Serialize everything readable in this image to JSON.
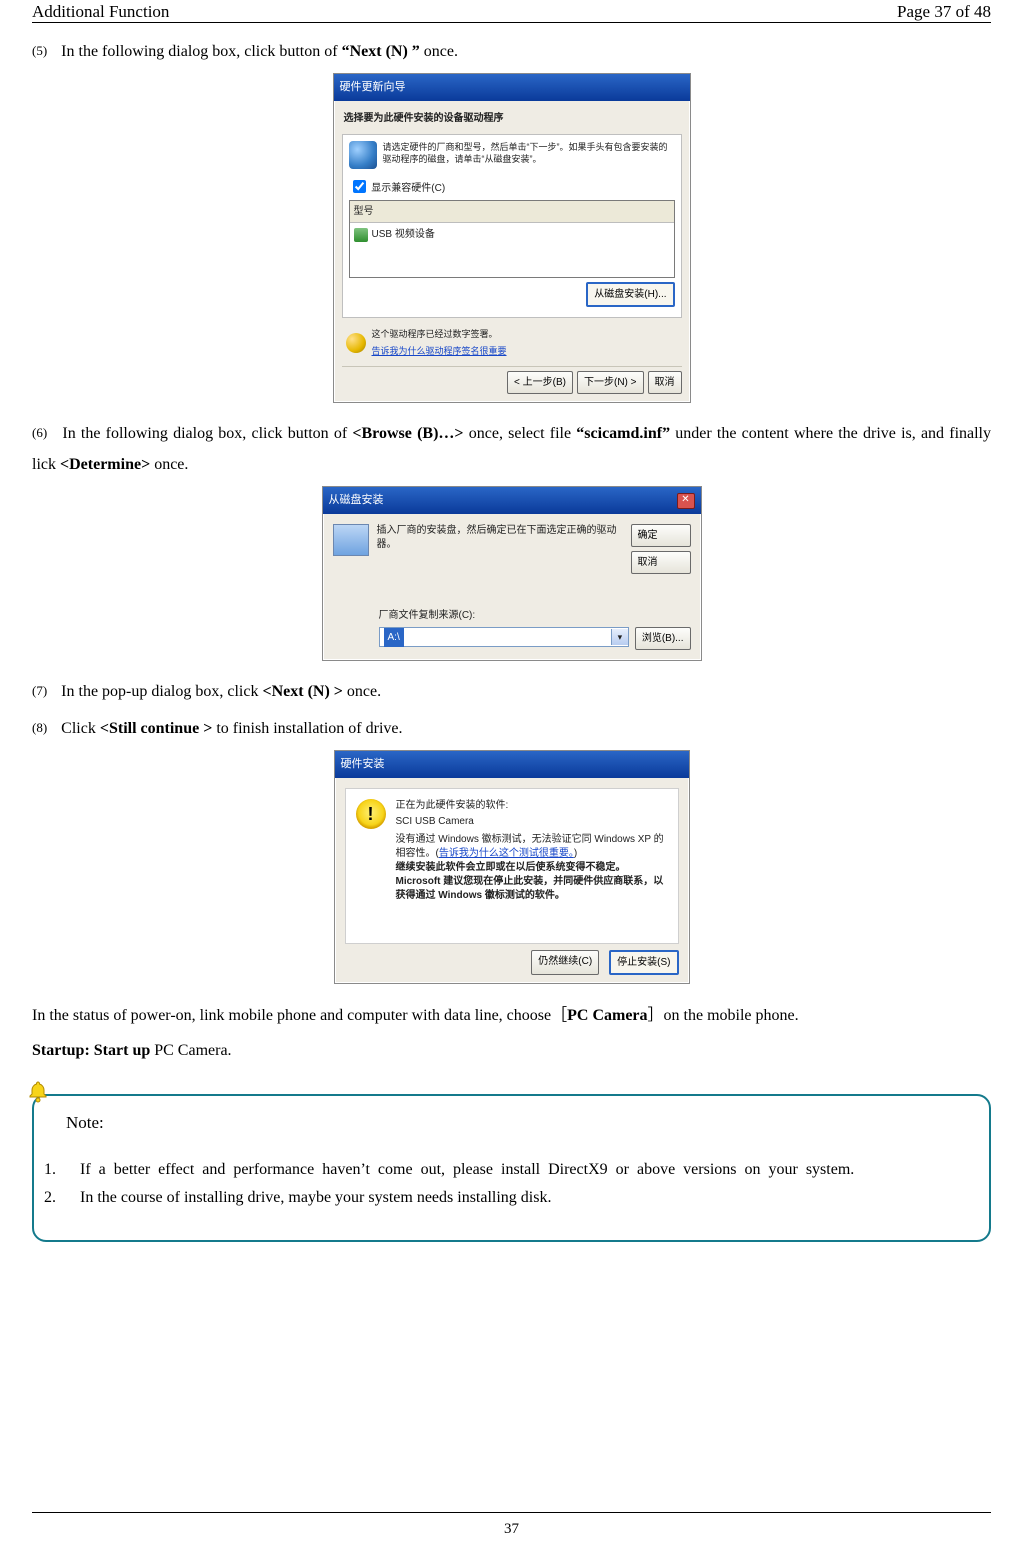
{
  "header": {
    "left": "Additional Function",
    "right": "Page 37 of 48"
  },
  "step5": {
    "num": "(5)",
    "pre": "In the following dialog box, click button of ",
    "bold": "“Next (N) ”",
    "post": " once."
  },
  "dlg1": {
    "title": "硬件更新向导",
    "sub": "选择要为此硬件安装的设备驱动程序",
    "desc": "请选定硬件的厂商和型号，然后单击“下一步”。如果手头有包含要安装的驱动程序的磁盘，请单击“从磁盘安装”。",
    "chk": "显示兼容硬件(C)",
    "listHeader": "型号",
    "listItem": "USB 视频设备",
    "diskBtn": "从磁盘安装(H)...",
    "signed": "这个驱动程序已经过数字签署。",
    "tellLink": "告诉我为什么驱动程序签名很重要",
    "back": "< 上一步(B)",
    "next": "下一步(N) >",
    "cancel": "取消"
  },
  "step6": {
    "num": "(6)",
    "pre": "In the following dialog box, click button of ",
    "b1": "<Browse (B)…>",
    "mid1": " once, select file ",
    "b2": "“scicamd.inf”",
    "mid2": " under the content where the drive is, and finally lick ",
    "b3": "<Determine>",
    "post": " once."
  },
  "dlg2": {
    "title": "从磁盘安装",
    "desc": "插入厂商的安装盘，然后确定已在下面选定正确的驱动器。",
    "ok": "确定",
    "cancel": "取消",
    "srcLabel": "厂商文件复制来源(C):",
    "selected": "A:\\",
    "browse": "浏览(B)..."
  },
  "step7": {
    "num": "(7)",
    "pre": "In the pop-up dialog box, click ",
    "b": "<Next (N) >",
    "post": " once."
  },
  "step8": {
    "num": "(8)",
    "pre": "Click",
    "b": "<Still continue >",
    "post": " to finish installation of drive."
  },
  "dlg3": {
    "title": "硬件安装",
    "l1": "正在为此硬件安装的软件:",
    "name": "SCI USB Camera",
    "l2a": "没有通过 Windows 徽标测试，无法验证它同 Windows XP 的相容性。(",
    "l2link": "告诉我为什么这个测试很重要。",
    "l2b": ")",
    "l3": "继续安装此软件会立即或在以后使系统变得不稳定。Microsoft 建议您现在停止此安装，并同硬件供应商联系，以获得通过 Windows 徽标测试的软件。",
    "cont": "仍然继续(C)",
    "stop": "停止安装(S)"
  },
  "para": {
    "pre": "In the status of power-on, link mobile phone and computer with data line, choose［",
    "b": "PC Camera",
    "post": "］on the mobile phone."
  },
  "startup": {
    "b": "Startup: Start up ",
    "t": "PC Camera."
  },
  "note": {
    "title": "Note:",
    "i1n": "1.",
    "i1t": "If a better effect and performance haven’t come out, please install DirectX9 or above versions on your system.",
    "i2n": "2.",
    "i2t": "In the course of installing drive, maybe your system needs installing disk."
  },
  "pageNum": "37"
}
